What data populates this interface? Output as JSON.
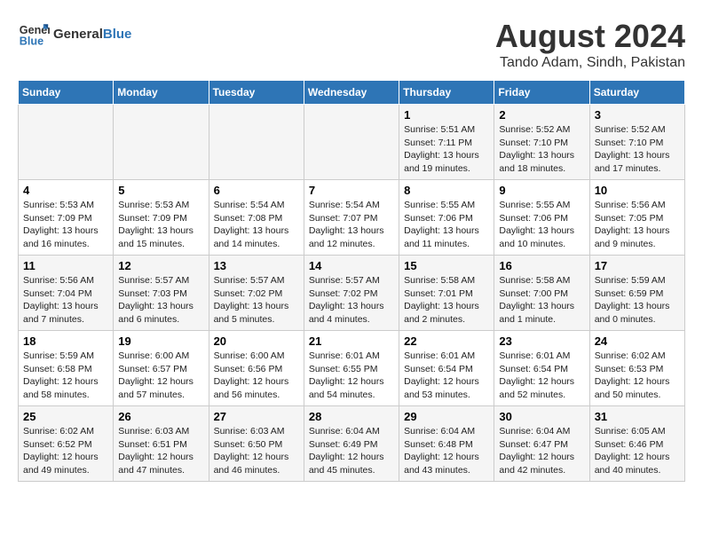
{
  "header": {
    "logo_line1": "General",
    "logo_line2": "Blue",
    "title": "August 2024",
    "subtitle": "Tando Adam, Sindh, Pakistan"
  },
  "days_of_week": [
    "Sunday",
    "Monday",
    "Tuesday",
    "Wednesday",
    "Thursday",
    "Friday",
    "Saturday"
  ],
  "weeks": [
    [
      {
        "day": "",
        "info": ""
      },
      {
        "day": "",
        "info": ""
      },
      {
        "day": "",
        "info": ""
      },
      {
        "day": "",
        "info": ""
      },
      {
        "day": "1",
        "info": "Sunrise: 5:51 AM\nSunset: 7:11 PM\nDaylight: 13 hours\nand 19 minutes."
      },
      {
        "day": "2",
        "info": "Sunrise: 5:52 AM\nSunset: 7:10 PM\nDaylight: 13 hours\nand 18 minutes."
      },
      {
        "day": "3",
        "info": "Sunrise: 5:52 AM\nSunset: 7:10 PM\nDaylight: 13 hours\nand 17 minutes."
      }
    ],
    [
      {
        "day": "4",
        "info": "Sunrise: 5:53 AM\nSunset: 7:09 PM\nDaylight: 13 hours\nand 16 minutes."
      },
      {
        "day": "5",
        "info": "Sunrise: 5:53 AM\nSunset: 7:09 PM\nDaylight: 13 hours\nand 15 minutes."
      },
      {
        "day": "6",
        "info": "Sunrise: 5:54 AM\nSunset: 7:08 PM\nDaylight: 13 hours\nand 14 minutes."
      },
      {
        "day": "7",
        "info": "Sunrise: 5:54 AM\nSunset: 7:07 PM\nDaylight: 13 hours\nand 12 minutes."
      },
      {
        "day": "8",
        "info": "Sunrise: 5:55 AM\nSunset: 7:06 PM\nDaylight: 13 hours\nand 11 minutes."
      },
      {
        "day": "9",
        "info": "Sunrise: 5:55 AM\nSunset: 7:06 PM\nDaylight: 13 hours\nand 10 minutes."
      },
      {
        "day": "10",
        "info": "Sunrise: 5:56 AM\nSunset: 7:05 PM\nDaylight: 13 hours\nand 9 minutes."
      }
    ],
    [
      {
        "day": "11",
        "info": "Sunrise: 5:56 AM\nSunset: 7:04 PM\nDaylight: 13 hours\nand 7 minutes."
      },
      {
        "day": "12",
        "info": "Sunrise: 5:57 AM\nSunset: 7:03 PM\nDaylight: 13 hours\nand 6 minutes."
      },
      {
        "day": "13",
        "info": "Sunrise: 5:57 AM\nSunset: 7:02 PM\nDaylight: 13 hours\nand 5 minutes."
      },
      {
        "day": "14",
        "info": "Sunrise: 5:57 AM\nSunset: 7:02 PM\nDaylight: 13 hours\nand 4 minutes."
      },
      {
        "day": "15",
        "info": "Sunrise: 5:58 AM\nSunset: 7:01 PM\nDaylight: 13 hours\nand 2 minutes."
      },
      {
        "day": "16",
        "info": "Sunrise: 5:58 AM\nSunset: 7:00 PM\nDaylight: 13 hours\nand 1 minute."
      },
      {
        "day": "17",
        "info": "Sunrise: 5:59 AM\nSunset: 6:59 PM\nDaylight: 13 hours\nand 0 minutes."
      }
    ],
    [
      {
        "day": "18",
        "info": "Sunrise: 5:59 AM\nSunset: 6:58 PM\nDaylight: 12 hours\nand 58 minutes."
      },
      {
        "day": "19",
        "info": "Sunrise: 6:00 AM\nSunset: 6:57 PM\nDaylight: 12 hours\nand 57 minutes."
      },
      {
        "day": "20",
        "info": "Sunrise: 6:00 AM\nSunset: 6:56 PM\nDaylight: 12 hours\nand 56 minutes."
      },
      {
        "day": "21",
        "info": "Sunrise: 6:01 AM\nSunset: 6:55 PM\nDaylight: 12 hours\nand 54 minutes."
      },
      {
        "day": "22",
        "info": "Sunrise: 6:01 AM\nSunset: 6:54 PM\nDaylight: 12 hours\nand 53 minutes."
      },
      {
        "day": "23",
        "info": "Sunrise: 6:01 AM\nSunset: 6:54 PM\nDaylight: 12 hours\nand 52 minutes."
      },
      {
        "day": "24",
        "info": "Sunrise: 6:02 AM\nSunset: 6:53 PM\nDaylight: 12 hours\nand 50 minutes."
      }
    ],
    [
      {
        "day": "25",
        "info": "Sunrise: 6:02 AM\nSunset: 6:52 PM\nDaylight: 12 hours\nand 49 minutes."
      },
      {
        "day": "26",
        "info": "Sunrise: 6:03 AM\nSunset: 6:51 PM\nDaylight: 12 hours\nand 47 minutes."
      },
      {
        "day": "27",
        "info": "Sunrise: 6:03 AM\nSunset: 6:50 PM\nDaylight: 12 hours\nand 46 minutes."
      },
      {
        "day": "28",
        "info": "Sunrise: 6:04 AM\nSunset: 6:49 PM\nDaylight: 12 hours\nand 45 minutes."
      },
      {
        "day": "29",
        "info": "Sunrise: 6:04 AM\nSunset: 6:48 PM\nDaylight: 12 hours\nand 43 minutes."
      },
      {
        "day": "30",
        "info": "Sunrise: 6:04 AM\nSunset: 6:47 PM\nDaylight: 12 hours\nand 42 minutes."
      },
      {
        "day": "31",
        "info": "Sunrise: 6:05 AM\nSunset: 6:46 PM\nDaylight: 12 hours\nand 40 minutes."
      }
    ]
  ]
}
